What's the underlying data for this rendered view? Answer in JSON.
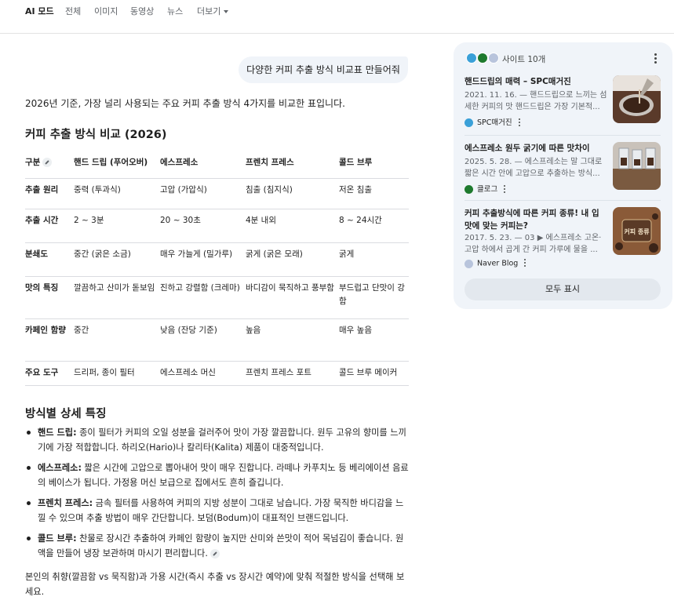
{
  "nav": {
    "tabs": [
      {
        "label": "AI 모드",
        "active": true
      },
      {
        "label": "전체"
      },
      {
        "label": "이미지"
      },
      {
        "label": "동영상"
      },
      {
        "label": "뉴스"
      },
      {
        "label": "더보기"
      }
    ]
  },
  "query": "다양한 커피 추출 방식 비교표 만들어줘",
  "intro": "2026년 기준, 가장 널리 사용되는 주요 커피 추출 방식 4가지를 비교한 표입니다.",
  "table_title": "커피 추출 방식 비교 (2026)",
  "table": {
    "headers": [
      "구분",
      "핸드 드립 (푸어오버)",
      "에스프레소",
      "프렌치 프레스",
      "콜드 브루"
    ],
    "rows": [
      [
        "추출 원리",
        "중력 (투과식)",
        "고압 (가압식)",
        "침출 (침지식)",
        "저온 침출"
      ],
      [
        "추출 시간",
        "2 ~ 3분",
        "20 ~ 30초",
        "4분 내외",
        "8 ~ 24시간"
      ],
      [
        "분쇄도",
        "중간 (굵은 소금)",
        "매우 가늘게 (밀가루)",
        "굵게 (굵은 모래)",
        "굵게"
      ],
      [
        "맛의 특징",
        "깔끔하고 산미가 돋보임",
        "진하고 강렬함 (크레마)",
        "바디감이 묵직하고 풍부함",
        "부드럽고 단맛이 강함"
      ],
      [
        "카페인 함량",
        "중간",
        "낮음 (잔당 기준)",
        "높음",
        "매우 높음"
      ],
      [
        "주요 도구",
        "드리퍼, 종이 필터",
        "에스프레소 머신",
        "프렌치 프레스 포트",
        "콜드 브루 메이커"
      ]
    ]
  },
  "details_title": "방식별 상세 특징",
  "details": [
    {
      "term": "핸드 드립:",
      "text": " 종이 필터가 커피의 오일 성분을 걸러주어 맛이 가장 깔끔합니다. 원두 고유의 향미를 느끼기에 가장 적합합니다. 하리오(Hario)나 칼리타(Kalita) 제품이 대중적입니다."
    },
    {
      "term": "에스프레소:",
      "text": " 짧은 시간에 고압으로 뽑아내어 맛이 매우 진합니다. 라떼나 카푸치노 등 베리에이션 음료의 베이스가 됩니다. 가정용 머신 보급으로 집에서도 흔히 즐깁니다."
    },
    {
      "term": "프렌치 프레스:",
      "text": " 금속 필터를 사용하여 커피의 지방 성분이 그대로 남습니다. 가장 묵직한 바디감을 느낄 수 있으며 추출 방법이 매우 간단합니다. 보덤(Bodum)이 대표적인 브랜드입니다."
    },
    {
      "term": "콜드 브루:",
      "text": " 찬물로 장시간 추출하여 카페인 함량이 높지만 산미와 쓴맛이 적어 목넘김이 좋습니다. 원액을 만들어 냉장 보관하며 마시기 편리합니다."
    }
  ],
  "closing": "본인의 취향(깔끔함 vs 묵직함)과 가용 시간(즉시 추출 vs 장시간 예약)에 맞춰 적절한 방식을 선택해 보세요.",
  "sources": {
    "label": "사이트 10개",
    "cards": [
      {
        "title": "핸드드립의 매력 – SPC매거진",
        "snippet_lines": [
          "2021. 11. 16. — 핸드드립으로 느끼는 섬",
          "세한 커피의 맛 핸드드립은 가장 기본적..."
        ],
        "source": "SPC매거진",
        "color": "#3aa0d8"
      },
      {
        "title": "에스프레소 원두 굵기에 따른 맛차이",
        "snippet_lines": [
          "2025. 5. 28. — 에스프레소는 말 그대로",
          "짧은 시간 안에 고압으로 추출하는 방식..."
        ],
        "source": "클로그",
        "color": "#1e7a2e"
      },
      {
        "title": "커피 추출방식에 따른 커피 종류! 내 입맛에 맞는 커피는?",
        "snippet_lines": [
          "2017. 5. 23. — 03 ▶ 에스프레소 고온·",
          "고압 하에서 곱게 간 커피 가루에 물을 ..."
        ],
        "source": "Naver Blog",
        "color": "#9aa7c7",
        "thumb_text": "커피 종류"
      }
    ],
    "show_all": "모두 표시"
  }
}
